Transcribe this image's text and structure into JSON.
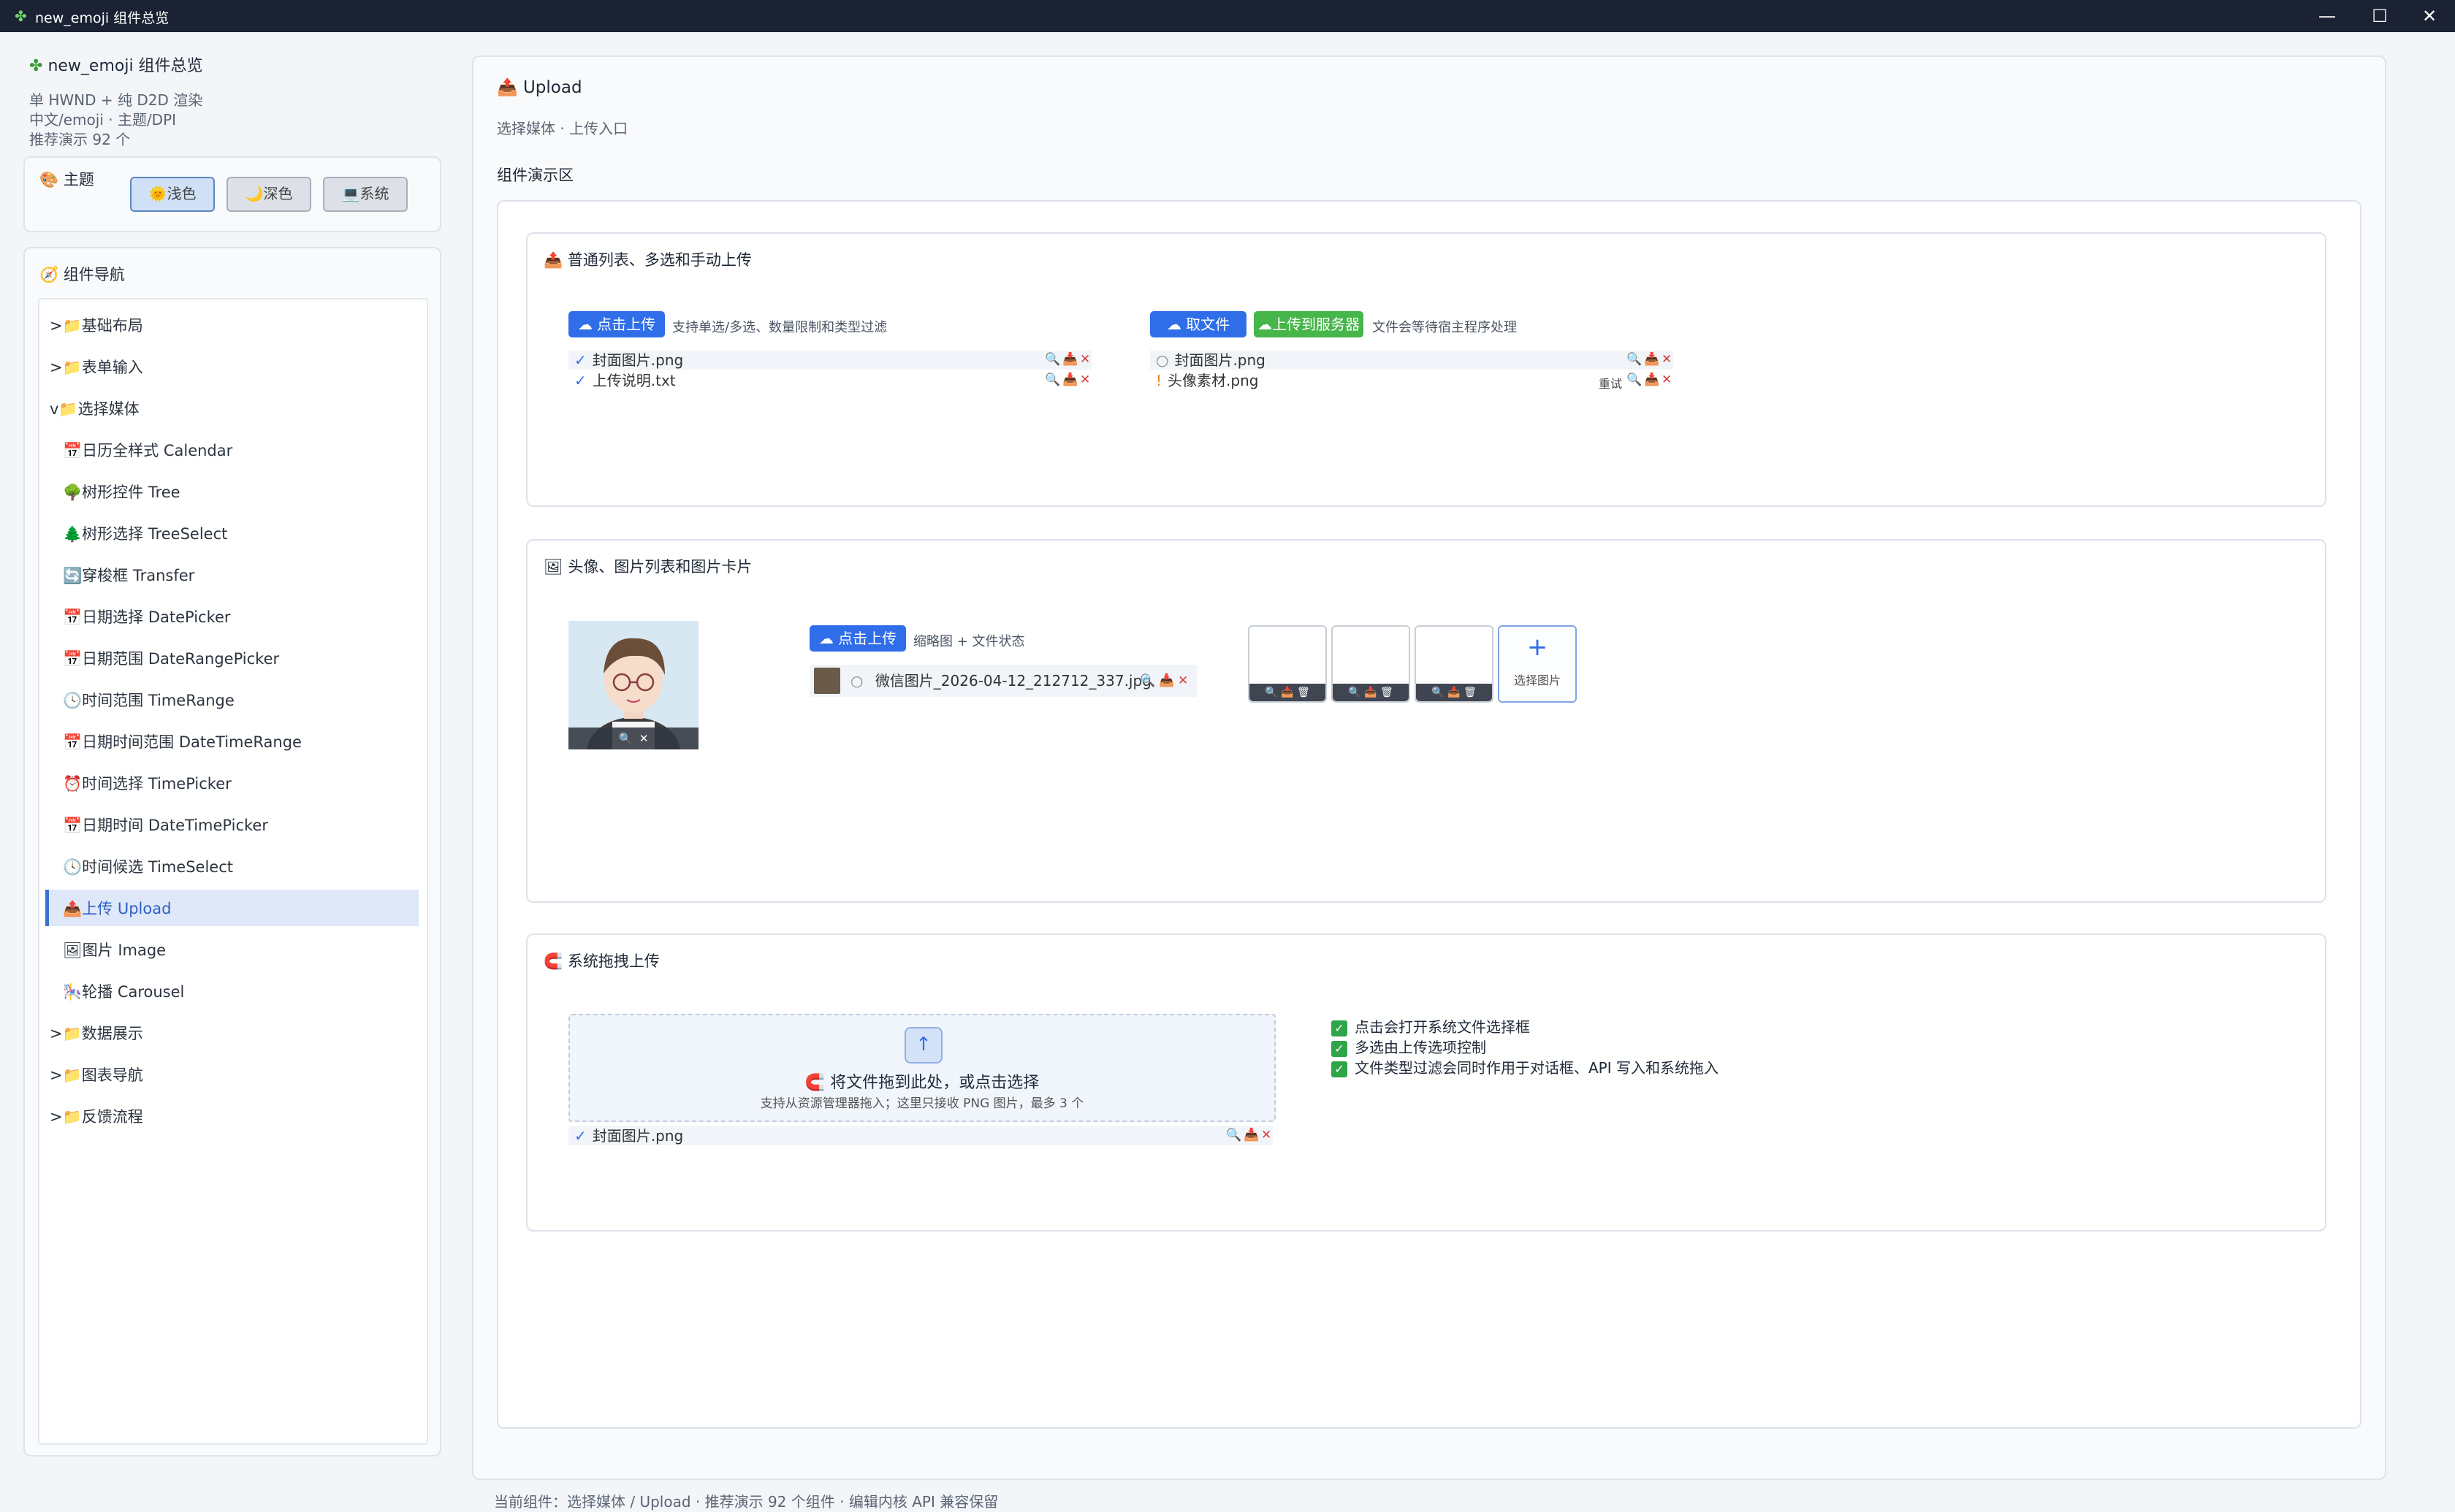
{
  "window": {
    "title": "new_emoji 组件总览",
    "min": "—",
    "max": "☐",
    "close": "✕"
  },
  "sidebar": {
    "app_title": "new_emoji 组件总览",
    "info": [
      "单 HWND + 纯 D2D 渲染",
      "中文/emoji · 主题/DPI",
      "推荐演示 92 个"
    ],
    "theme_title": "主题",
    "themes": [
      {
        "label": "浅色",
        "icon": "🌞"
      },
      {
        "label": "深色",
        "icon": "🌙"
      },
      {
        "label": "系统",
        "icon": "💻"
      }
    ],
    "nav_title": "组件导航",
    "nav_items": [
      {
        "label": ">📁基础布局"
      },
      {
        "label": ">📁表单输入"
      },
      {
        "label": "v📁选择媒体"
      },
      {
        "label": "📅日历全样式 Calendar"
      },
      {
        "label": "🌳树形控件 Tree"
      },
      {
        "label": "🌲树形选择 TreeSelect"
      },
      {
        "label": "🔄穿梭框 Transfer"
      },
      {
        "label": "📅日期选择 DatePicker"
      },
      {
        "label": "📅日期范围 DateRangePicker"
      },
      {
        "label": "🕓时间范围 TimeRange"
      },
      {
        "label": "📅日期时间范围 DateTimeRange"
      },
      {
        "label": "⏰时间选择 TimePicker"
      },
      {
        "label": "📅日期时间 DateTimePicker"
      },
      {
        "label": "🕓时间候选 TimeSelect"
      },
      {
        "label": "📤上传 Upload"
      },
      {
        "label": "🖼图片 Image"
      },
      {
        "label": "🎠轮播 Carousel"
      },
      {
        "label": ">📁数据展示"
      },
      {
        "label": ">📁图表导航"
      },
      {
        "label": ">📁反馈流程"
      }
    ]
  },
  "main": {
    "title": "Upload",
    "subtitle": "选择媒体 · 上传入口",
    "demo_label": "组件演示区",
    "section1": {
      "title": "普通列表、多选和手动上传",
      "upload_btn": "点击上传",
      "upload_hint": "支持单选/多选、数量限制和类型过滤",
      "files_left": [
        {
          "mark": "✓",
          "name": "封面图片.png"
        },
        {
          "mark": "✓",
          "name": "上传说明.txt"
        }
      ],
      "pick_btn": "取文件",
      "server_btn": "上传到服务器",
      "server_hint": "文件会等待宿主程序处理",
      "files_right": [
        {
          "mark": "○",
          "name": "封面图片.png",
          "retry": ""
        },
        {
          "mark": "!",
          "name": "头像素材.png",
          "retry": "重试"
        }
      ]
    },
    "section2": {
      "title": "头像、图片列表和图片卡片",
      "upload_btn": "点击上传",
      "hint": "缩略图 + 文件状态",
      "file": {
        "mark": "○",
        "name": "微信图片_2026-04-12_212712_337.jpg"
      },
      "add_card_label": "选择图片",
      "add_card_plus": "+"
    },
    "section3": {
      "title": "系统拖拽上传",
      "drop_title": "将文件拖到此处，或点击选择",
      "drop_hint": "支持从资源管理器拖入；这里只接收 PNG 图片，最多 3 个",
      "file": {
        "mark": "✓",
        "name": "封面图片.png"
      },
      "checks": [
        "点击会打开系统文件选择框",
        "多选由上传选项控制",
        "文件类型过滤会同时作用于对话框、API 写入和系统拖入"
      ]
    },
    "status": "当前组件：选择媒体 / Upload · 推荐演示 92 个组件 · 编辑内核 API 兼容保留"
  },
  "colors": {
    "accent": "#2f6ee8",
    "success": "#46b54a",
    "danger": "#d93b3b",
    "titlebar": "#1b2233"
  }
}
